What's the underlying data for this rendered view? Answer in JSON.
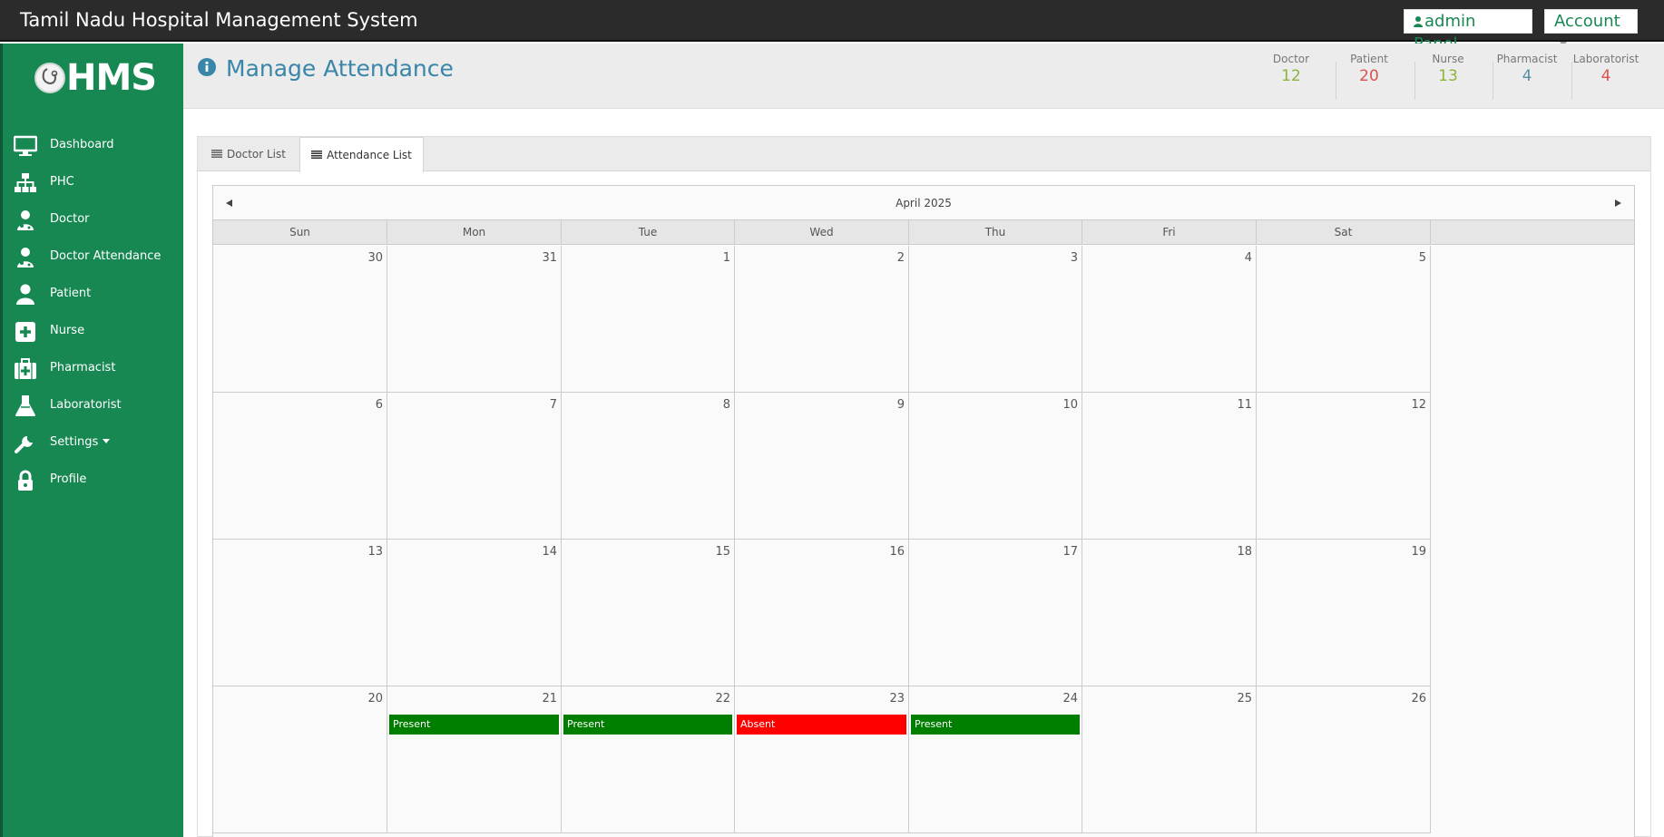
{
  "app": {
    "title": "Tamil Nadu Hospital Management System",
    "admin_label": "admin Panel",
    "account_label": "Account"
  },
  "sidebar": {
    "logo_text": "HMS",
    "items": [
      {
        "label": "Dashboard",
        "icon": "monitor-icon"
      },
      {
        "label": "PHC",
        "icon": "sitemap-icon"
      },
      {
        "label": "Doctor",
        "icon": "doctor-icon"
      },
      {
        "label": "Doctor Attendance",
        "icon": "doctor-icon"
      },
      {
        "label": "Patient",
        "icon": "user-icon"
      },
      {
        "label": "Nurse",
        "icon": "plus-square-icon"
      },
      {
        "label": "Pharmacist",
        "icon": "medkit-icon"
      },
      {
        "label": "Laboratorist",
        "icon": "flask-icon"
      },
      {
        "label": "Settings",
        "icon": "wrench-icon"
      },
      {
        "label": "Profile",
        "icon": "lock-icon"
      }
    ]
  },
  "header": {
    "title": "Manage Attendance",
    "stats": [
      {
        "label": "Doctor",
        "value": "12",
        "color": "#8cb33a"
      },
      {
        "label": "Patient",
        "value": "20",
        "color": "#d9534f"
      },
      {
        "label": "Nurse",
        "value": "13",
        "color": "#8cb33a"
      },
      {
        "label": "Pharmacist",
        "value": "4",
        "color": "#5a8fa8"
      },
      {
        "label": "Laboratorist",
        "value": "4",
        "color": "#d9534f"
      }
    ]
  },
  "tabs": [
    {
      "label": "Doctor List"
    },
    {
      "label": "Attendance List"
    }
  ],
  "calendar": {
    "month_label": "April 2025",
    "days_of_week": [
      "Sun",
      "Mon",
      "Tue",
      "Wed",
      "Thu",
      "Fri",
      "Sat"
    ],
    "weeks": [
      [
        {
          "n": "30"
        },
        {
          "n": "31"
        },
        {
          "n": "1"
        },
        {
          "n": "2"
        },
        {
          "n": "3"
        },
        {
          "n": "4"
        },
        {
          "n": "5"
        }
      ],
      [
        {
          "n": "6"
        },
        {
          "n": "7"
        },
        {
          "n": "8"
        },
        {
          "n": "9"
        },
        {
          "n": "10"
        },
        {
          "n": "11"
        },
        {
          "n": "12"
        }
      ],
      [
        {
          "n": "13"
        },
        {
          "n": "14"
        },
        {
          "n": "15"
        },
        {
          "n": "16"
        },
        {
          "n": "17"
        },
        {
          "n": "18"
        },
        {
          "n": "19"
        }
      ],
      [
        {
          "n": "20"
        },
        {
          "n": "21",
          "event": "Present"
        },
        {
          "n": "22",
          "event": "Present"
        },
        {
          "n": "23",
          "event": "Absent"
        },
        {
          "n": "24",
          "event": "Present"
        },
        {
          "n": "25"
        },
        {
          "n": "26"
        }
      ]
    ]
  },
  "colors": {
    "sidebar": "#178852",
    "topbar": "#2b2b2b",
    "present": "#007e00",
    "absent": "#ff0000",
    "title": "#3a86a8"
  }
}
